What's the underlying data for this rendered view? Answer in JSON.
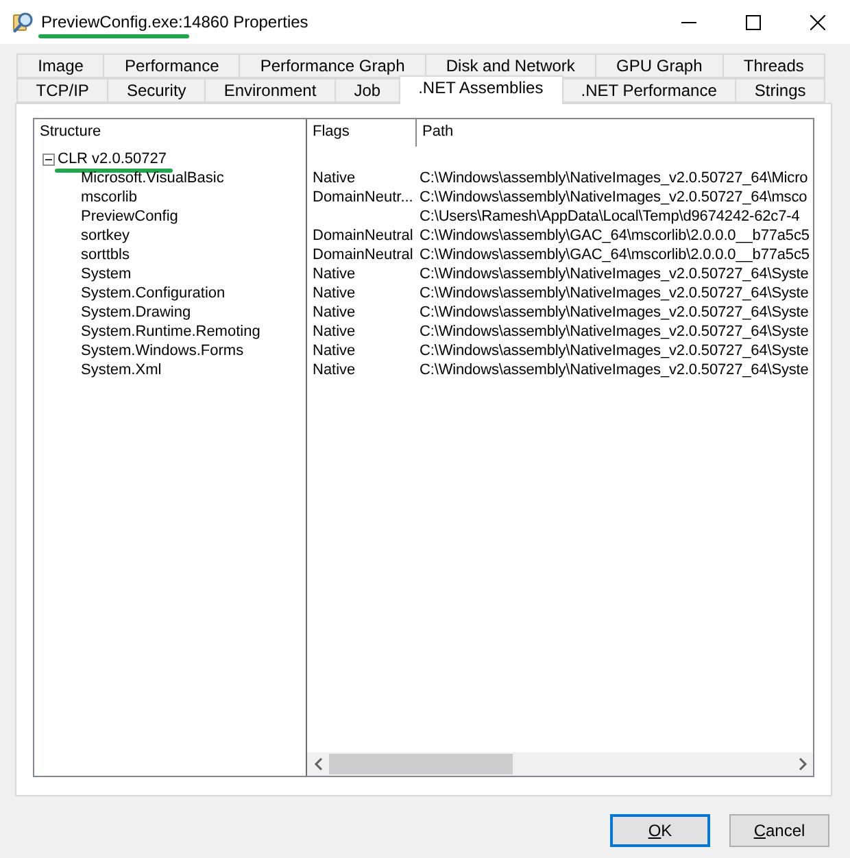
{
  "window": {
    "title": "PreviewConfig.exe:14860 Properties"
  },
  "tab_rows": [
    [
      {
        "label": "Image",
        "selected": false
      },
      {
        "label": "Performance",
        "selected": false
      },
      {
        "label": "Performance Graph",
        "selected": false
      },
      {
        "label": "Disk and Network",
        "selected": false
      },
      {
        "label": "GPU Graph",
        "selected": false
      },
      {
        "label": "Threads",
        "selected": false
      }
    ],
    [
      {
        "label": "TCP/IP",
        "selected": false
      },
      {
        "label": "Security",
        "selected": false
      },
      {
        "label": "Environment",
        "selected": false
      },
      {
        "label": "Job",
        "selected": false
      },
      {
        "label": ".NET Assemblies",
        "selected": true
      },
      {
        "label": ".NET Performance",
        "selected": false
      },
      {
        "label": "Strings",
        "selected": false
      }
    ]
  ],
  "tree": {
    "column": "Structure",
    "items": [
      {
        "label": "CLR v2.0.50727",
        "expanded": true,
        "children": [
          {
            "label": "Microsoft.VisualBasic",
            "flags": "Native",
            "path": "C:\\Windows\\assembly\\NativeImages_v2.0.50727_64\\Micro"
          },
          {
            "label": "mscorlib",
            "flags": "DomainNeutr...",
            "path": "C:\\Windows\\assembly\\NativeImages_v2.0.50727_64\\msco"
          },
          {
            "label": "PreviewConfig",
            "path": "C:\\Users\\Ramesh\\AppData\\Local\\Temp\\d9674242-62c7-4"
          },
          {
            "label": "sortkey",
            "flags": "DomainNeutral",
            "path": "C:\\Windows\\assembly\\GAC_64\\mscorlib\\2.0.0.0__b77a5c5"
          },
          {
            "label": "sorttbls",
            "flags": "DomainNeutral",
            "path": "C:\\Windows\\assembly\\GAC_64\\mscorlib\\2.0.0.0__b77a5c5"
          },
          {
            "label": "System",
            "flags": "Native",
            "path": "C:\\Windows\\assembly\\NativeImages_v2.0.50727_64\\Syste"
          },
          {
            "label": "System.Configuration",
            "flags": "Native",
            "path": "C:\\Windows\\assembly\\NativeImages_v2.0.50727_64\\Syste"
          },
          {
            "label": "System.Drawing",
            "flags": "Native",
            "path": "C:\\Windows\\assembly\\NativeImages_v2.0.50727_64\\Syste"
          },
          {
            "label": "System.Runtime.Remoting",
            "flags": "Native",
            "path": "C:\\Windows\\assembly\\NativeImages_v2.0.50727_64\\Syste"
          },
          {
            "label": "System.Windows.Forms",
            "flags": "Native",
            "path": "C:\\Windows\\assembly\\NativeImages_v2.0.50727_64\\Syste"
          },
          {
            "label": "System.Xml",
            "flags": "Native",
            "path": "C:\\Windows\\assembly\\NativeImages_v2.0.50727_64\\Syste"
          }
        ]
      }
    ]
  },
  "list": {
    "columns": [
      "Flags",
      "Path"
    ]
  },
  "buttons": [
    {
      "label": "OK",
      "default": true
    },
    {
      "label": "Cancel",
      "default": false
    }
  ]
}
